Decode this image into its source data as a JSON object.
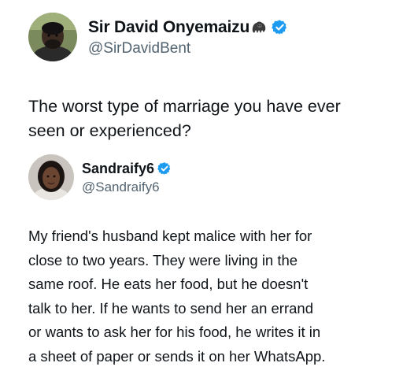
{
  "tweet": {
    "author": {
      "display_name": "Sir David Onyemaizu",
      "handle": "@SirDavidBent",
      "emoji_icon": "gorilla-emoji",
      "verified": true
    },
    "text": "The worst type of marriage you have ever seen or experienced?",
    "text_lines": [
      "The worst type of marriage you have ever",
      "seen or experienced?"
    ]
  },
  "reply": {
    "author": {
      "display_name": "Sandraify6",
      "handle": "@Sandraify6",
      "verified": true
    },
    "text_lines": [
      "My friend's husband kept malice with her for",
      "close to two years. They were living in the",
      "same roof. He eats her food, but he doesn't",
      "talk to her. If he wants to send her an errand",
      "or wants to ask her for his food, he writes it in",
      "a sheet of paper or sends it on her WhatsApp."
    ]
  },
  "colors": {
    "text_primary": "#0f1419",
    "text_secondary": "#536471",
    "verified_blue": "#1d9bf0",
    "background": "#ffffff"
  }
}
